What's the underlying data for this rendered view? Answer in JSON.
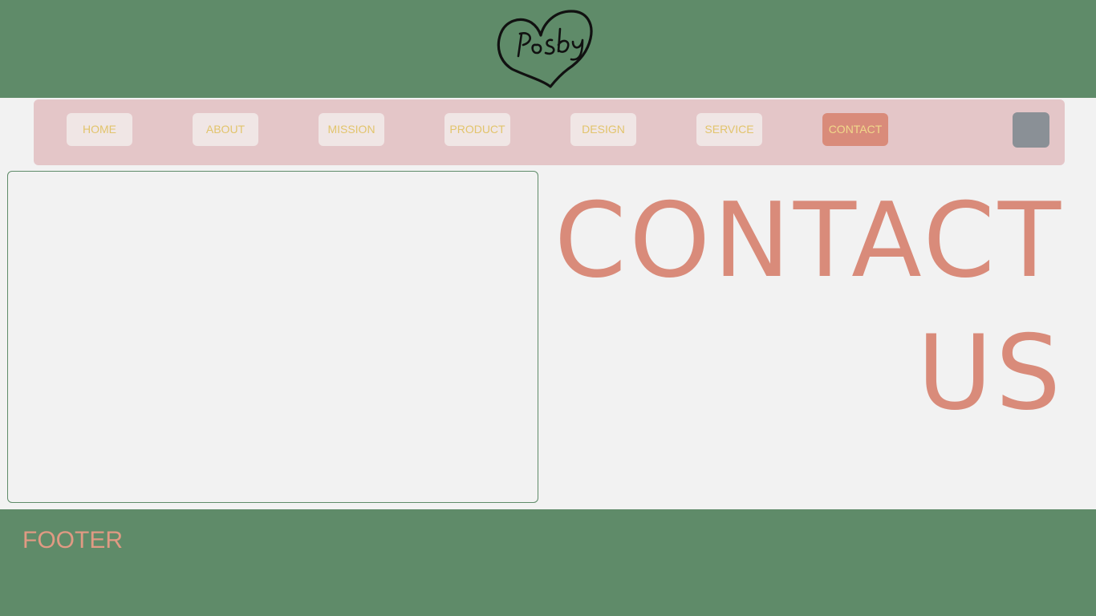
{
  "brand": {
    "logo_text": "Posby"
  },
  "nav": {
    "items": [
      {
        "label": "HOME",
        "active": false
      },
      {
        "label": "ABOUT",
        "active": false
      },
      {
        "label": "MISSION",
        "active": false
      },
      {
        "label": "PRODUCT",
        "active": false
      },
      {
        "label": "DESIGN",
        "active": false
      },
      {
        "label": "SERVICE",
        "active": false
      },
      {
        "label": "CONTACT",
        "active": true
      }
    ]
  },
  "hero": {
    "line1": "CONTACT",
    "line2": "US"
  },
  "footer": {
    "label": "FOOTER"
  },
  "colors": {
    "header_bg": "#5f8b69",
    "nav_bg": "#e4c6c8",
    "nav_text": "#e2c46c",
    "accent": "#d98b7a",
    "page_bg": "#f2f2f2"
  }
}
